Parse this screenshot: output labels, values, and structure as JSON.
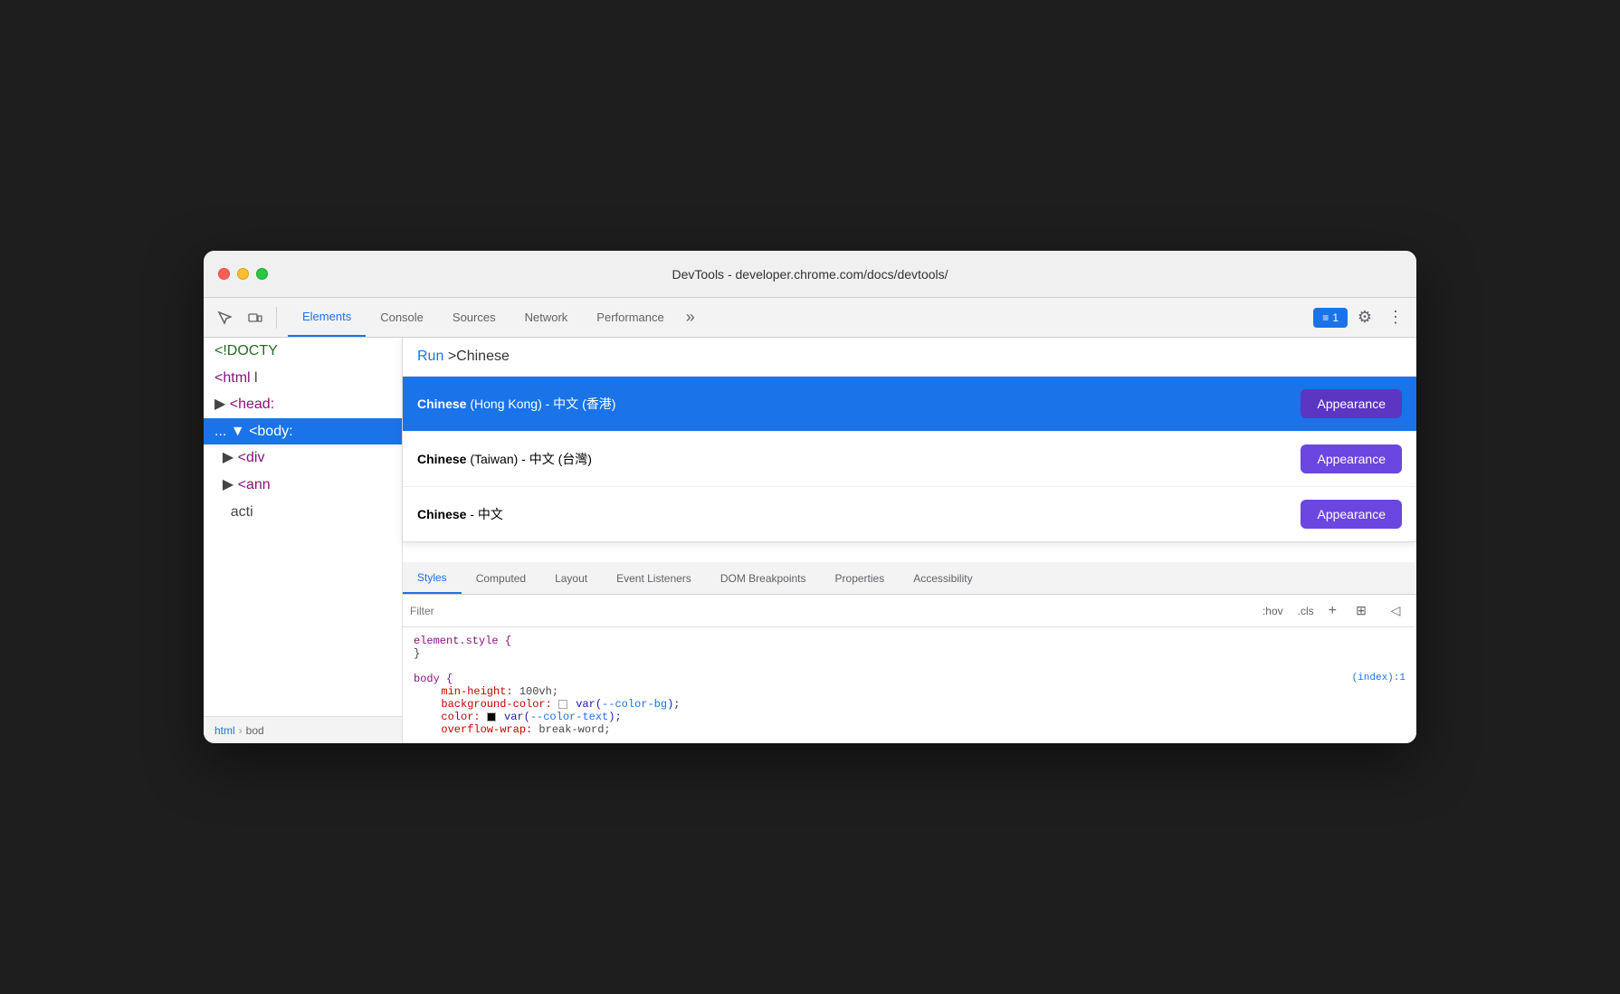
{
  "window": {
    "title": "DevTools - developer.chrome.com/docs/devtools/"
  },
  "toolbar": {
    "tabs": [
      {
        "id": "elements",
        "label": "Elements",
        "active": true
      },
      {
        "id": "console",
        "label": "Console",
        "active": false
      },
      {
        "id": "sources",
        "label": "Sources",
        "active": false
      },
      {
        "id": "network",
        "label": "Network",
        "active": false
      },
      {
        "id": "performance",
        "label": "Performance",
        "active": false
      }
    ],
    "more_label": "»",
    "badge_label": "≡ 1",
    "settings_icon": "⚙",
    "more_icon": "⋮"
  },
  "dom": {
    "lines": [
      {
        "text": "<!DOCTY",
        "type": "comment"
      },
      {
        "text": "<html l",
        "type": "tag"
      },
      {
        "text": "▶ <head:",
        "type": "tag"
      },
      {
        "text": "... ▼ <body:",
        "type": "tag",
        "selected": true
      },
      {
        "text": "  ▶ <div",
        "type": "tag"
      },
      {
        "text": "  ▶ <ann",
        "type": "tag"
      },
      {
        "text": "    acti",
        "type": "attr"
      }
    ]
  },
  "breadcrumb": {
    "items": [
      "html",
      "bod"
    ]
  },
  "dropdown": {
    "search_prefix": "Run",
    "search_value": ">Chinese",
    "items": [
      {
        "id": "hong-kong",
        "bold": "Chinese",
        "rest": " (Hong Kong) - 中文 (香港)",
        "button_label": "Appearance",
        "highlighted": true
      },
      {
        "id": "taiwan",
        "bold": "Chinese",
        "rest": " (Taiwan) - 中文 (台灣)",
        "button_label": "Appearance",
        "highlighted": false
      },
      {
        "id": "chinese",
        "bold": "Chinese",
        "rest": " - 中文",
        "button_label": "Appearance",
        "highlighted": false
      }
    ]
  },
  "panel_tabs": {
    "tabs": [
      {
        "id": "styles",
        "label": "Styles",
        "active": true
      },
      {
        "id": "computed",
        "label": "Computed",
        "active": false
      },
      {
        "id": "layout",
        "label": "Layout",
        "active": false
      },
      {
        "id": "event-listeners",
        "label": "Event Listeners",
        "active": false
      },
      {
        "id": "dom-breakpoints",
        "label": "DOM Breakpoints",
        "active": false
      },
      {
        "id": "properties",
        "label": "Properties",
        "active": false
      },
      {
        "id": "accessibility",
        "label": "Accessibility",
        "active": false
      }
    ]
  },
  "filter": {
    "placeholder": "Filter",
    "hov_label": ":hov",
    "cls_label": ".cls",
    "plus_label": "+"
  },
  "css_rules": [
    {
      "selector": "element.style {",
      "close": "}",
      "properties": []
    },
    {
      "selector": "body {",
      "source": "(index):1",
      "close": "}",
      "properties": [
        {
          "name": "min-height:",
          "value": "100vh;"
        },
        {
          "name": "background-color:",
          "value": "var(--color-bg);",
          "swatch": "white",
          "has_var": true
        },
        {
          "name": "color:",
          "value": "var(--color-text);",
          "swatch": "black",
          "has_var": true
        },
        {
          "name": "overflow-wrap:",
          "value": "break-word;"
        }
      ]
    }
  ]
}
